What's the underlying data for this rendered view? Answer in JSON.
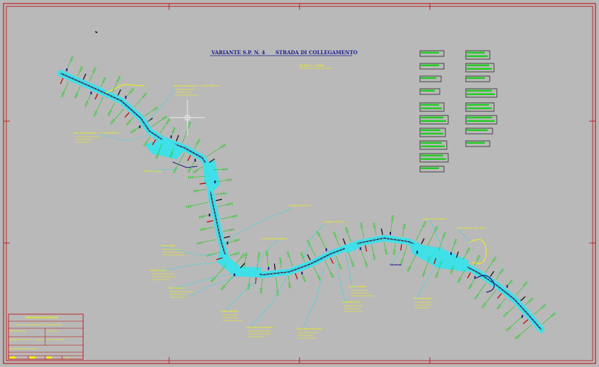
{
  "header": {
    "title_left": "VARIANTE   S.P.  N.  4",
    "title_right": "STRADA  DI  COLLEGAMENTO",
    "scale": "SCALA  1 : 2000"
  },
  "colors": {
    "background": "#b9b9b9",
    "frame_red": "#c00000",
    "road_fill": "#3fe0e8",
    "road_axis": "#1a1a80",
    "annotation_cyan": "#38d8e0",
    "text_yellow": "#f5f500",
    "text_blue": "#1a1a90",
    "legend_green": "#22cc22"
  },
  "labels": [
    "Rete di derivazione  n = 1,00-2000 ml.",
    "asse di derivazione  n = 1,00-1000 ml.",
    "Asse di bypass",
    "Guado km 0,50 m.",
    "Guado km 2,00 m.",
    "Area di sosta pubblico",
    "Svincolo km 2,60 m.",
    "Rete di scarico  km 3,10",
    "Vicenza",
    "Tratto Ponte",
    "Tratto Galleria",
    "Tratto Argine",
    "Tratto Viadotto",
    "Tratto Strada Asfaltata",
    "Tratto Nuovo tracciato",
    "Tratto Ripristino",
    "Tratto Variante",
    "Tratto Rotatoria"
  ],
  "title_block": {
    "rows": [
      "PROVINCIA  DI  VICENZA",
      "Centro  di  progettazione  per  le  opere  pubbliche",
      "Settore Viabilita'",
      "Ing. Tecnico",
      "Strada Provinciale S.P. n. 4 - Variante",
      "Comune di Bassano",
      "Planimetria  Tavola di Rilievo",
      "2000"
    ]
  }
}
